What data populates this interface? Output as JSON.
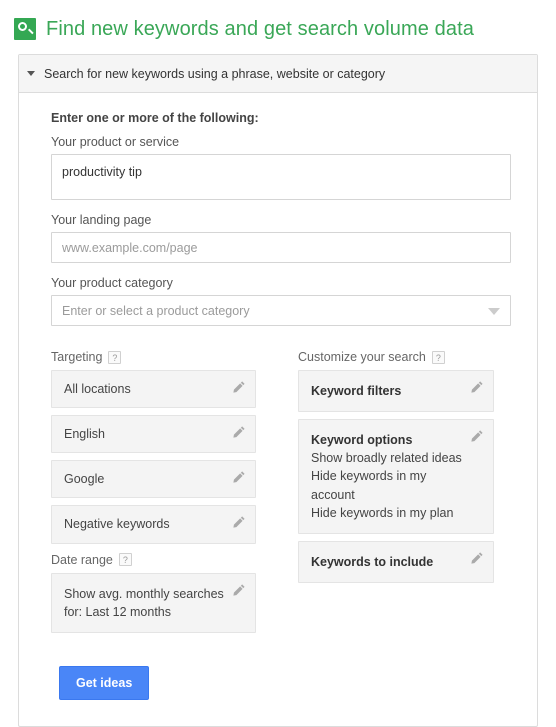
{
  "page": {
    "title": "Find new keywords and get search volume data",
    "title_icon": "search-icon",
    "accent_green": "#3aa757",
    "accent_blue": "#4a86f7"
  },
  "panel": {
    "header_label": "Search for new keywords using a phrase, website or category",
    "caret_icon": "chevron-down-icon"
  },
  "form": {
    "heading": "Enter one or more of the following:",
    "product_or_service": {
      "label": "Your product or service",
      "value": "productivity tip"
    },
    "landing_page": {
      "label": "Your landing page",
      "placeholder": "www.example.com/page",
      "value": ""
    },
    "product_category": {
      "label": "Your product category",
      "placeholder": "Enter or select a product category",
      "value": "",
      "arrow_icon": "chevron-down-icon"
    }
  },
  "targeting": {
    "label": "Targeting",
    "help": "?",
    "items": [
      {
        "label": "All locations",
        "edit_icon": "pencil-icon"
      },
      {
        "label": "English",
        "edit_icon": "pencil-icon"
      },
      {
        "label": "Google",
        "edit_icon": "pencil-icon"
      },
      {
        "label": "Negative keywords",
        "edit_icon": "pencil-icon"
      }
    ]
  },
  "date_range": {
    "label": "Date range",
    "help": "?",
    "value": "Show avg. monthly searches for: Last 12 months",
    "edit_icon": "pencil-icon"
  },
  "customize": {
    "label": "Customize your search",
    "help": "?",
    "keyword_filters": {
      "title": "Keyword filters",
      "edit_icon": "pencil-icon"
    },
    "keyword_options": {
      "title": "Keyword options",
      "lines": [
        "Show broadly related ideas",
        "Hide keywords in my account",
        "Hide keywords in my plan"
      ],
      "edit_icon": "pencil-icon"
    },
    "keywords_to_include": {
      "title": "Keywords to include",
      "edit_icon": "pencil-icon"
    }
  },
  "actions": {
    "get_ideas_label": "Get ideas"
  }
}
